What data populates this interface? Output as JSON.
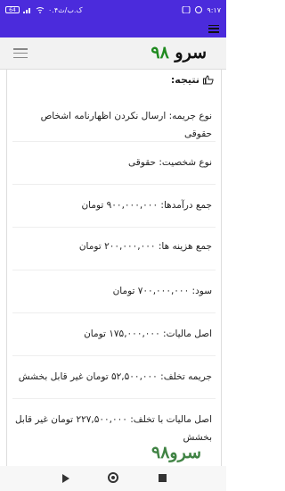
{
  "status_bar": {
    "time": "۹:۱۷",
    "net_speed": "۰.۴ک.ب/ث",
    "battery": "64"
  },
  "header": {
    "logo_text": "سرو",
    "logo_number": "۹۸"
  },
  "result": {
    "heading": "نتیجه:",
    "rows": [
      "نوع جریمه: ارسال نکردن اظهارنامه اشخاص حقوقی",
      "نوع شخصیت: حقوقی",
      "جمع درآمدها: ۹۰۰,۰۰۰,۰۰۰ تومان",
      "جمع هزینه ها: ۲۰۰,۰۰۰,۰۰۰ تومان",
      "سود: ۷۰۰,۰۰۰,۰۰۰ تومان",
      "اصل مالیات: ۱۷۵,۰۰۰,۰۰۰ تومان",
      "جریمه تخلف: ۵۲,۵۰۰,۰۰۰ تومان غیر قابل بخشش",
      "اصل مالیات با تخلف: ۲۲۷,۵۰۰,۰۰۰ تومان غیر قابل بخشش"
    ]
  },
  "watermark": "سرو۹۸",
  "colors": {
    "accent": "#4b2bdc",
    "logo_green": "#1f8a1f"
  }
}
